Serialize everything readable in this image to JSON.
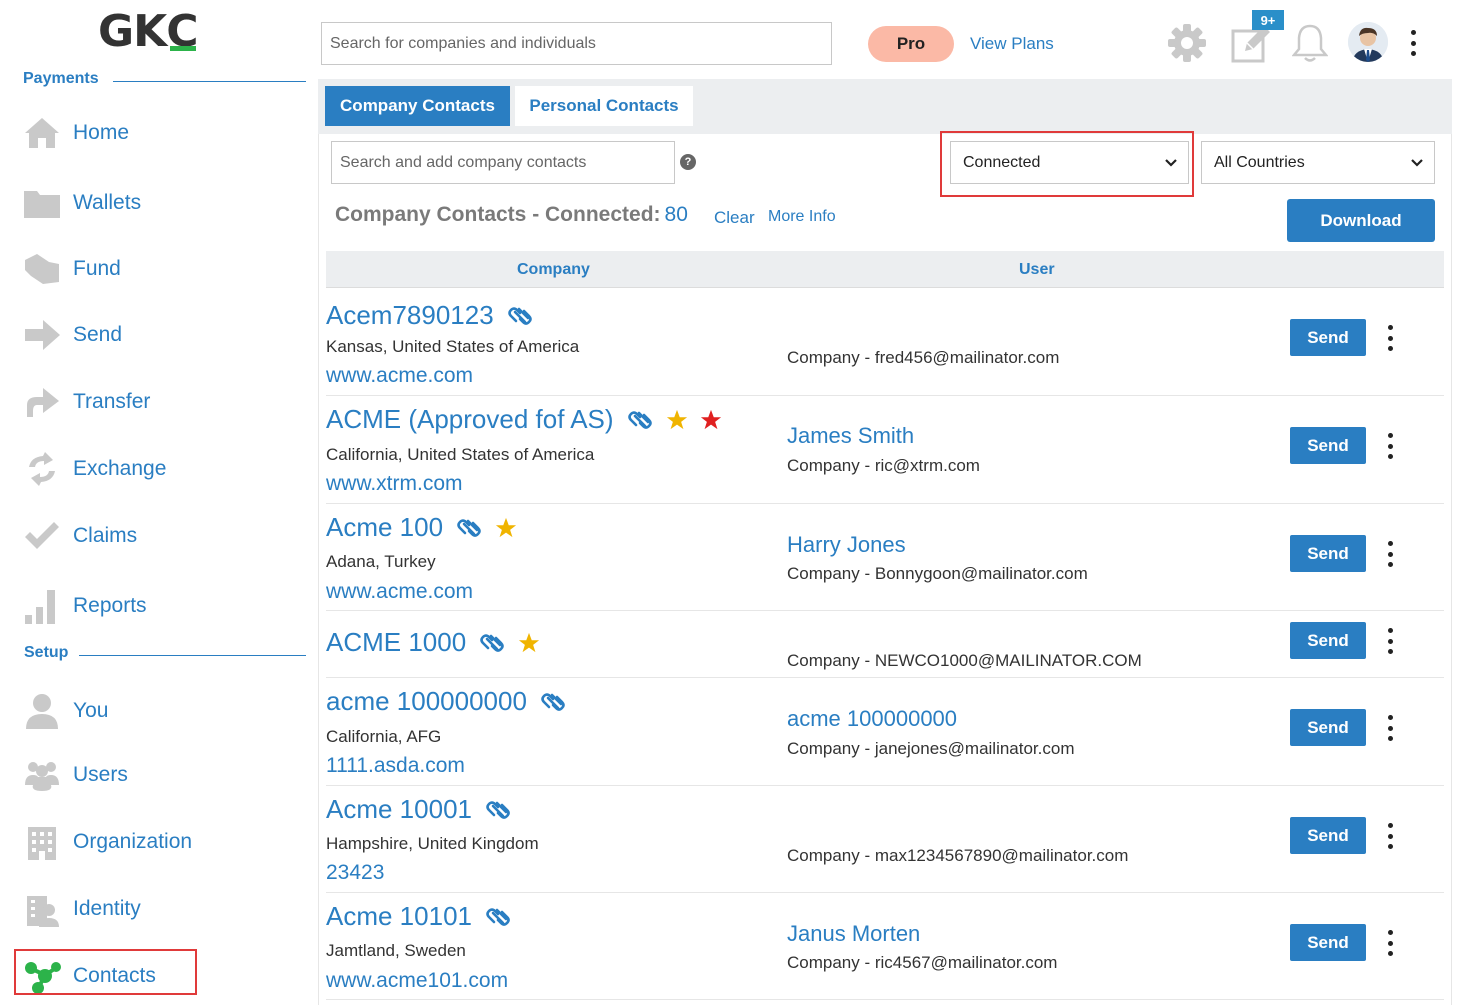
{
  "app": {
    "logo_text_main": "GK",
    "logo_text_c": "C"
  },
  "colors": {
    "accent": "#2a7ec2",
    "brand_green": "#2cb34a",
    "pro_badge": "#fbb9a6",
    "highlight": "#e03a3a",
    "star_gold": "#f0b400",
    "star_red": "#e02020"
  },
  "sidebar": {
    "payments_label": "Payments",
    "setup_label": "Setup",
    "payments_items": [
      {
        "label": "Home",
        "icon": "home-icon"
      },
      {
        "label": "Wallets",
        "icon": "folder-icon"
      },
      {
        "label": "Fund",
        "icon": "fund-icon"
      },
      {
        "label": "Send",
        "icon": "arrow-right-icon"
      },
      {
        "label": "Transfer",
        "icon": "transfer-icon"
      },
      {
        "label": "Exchange",
        "icon": "exchange-icon"
      },
      {
        "label": "Claims",
        "icon": "check-icon"
      },
      {
        "label": "Reports",
        "icon": "bar-chart-icon"
      }
    ],
    "setup_items": [
      {
        "label": "You",
        "icon": "user-icon"
      },
      {
        "label": "Users",
        "icon": "users-icon"
      },
      {
        "label": "Organization",
        "icon": "building-icon"
      },
      {
        "label": "Identity",
        "icon": "identity-icon"
      },
      {
        "label": "Contacts",
        "icon": "contacts-icon"
      }
    ]
  },
  "topbar": {
    "search_placeholder": "Search for companies and individuals",
    "pro_label": "Pro",
    "view_plans_label": "View Plans",
    "notes_badge": "9+"
  },
  "tabs": [
    {
      "label": "Company Contacts",
      "active": true
    },
    {
      "label": "Personal Contacts",
      "active": false
    }
  ],
  "filters": {
    "contact_search_placeholder": "Search and add company contacts",
    "help_glyph": "?",
    "status_value": "Connected",
    "country_value": "All Countries"
  },
  "summary": {
    "label": "Company Contacts - Connected:",
    "count": "80",
    "clear_label": "Clear",
    "more_info_label": "More Info",
    "download_label": "Download"
  },
  "table": {
    "headers": {
      "company": "Company",
      "user": "User"
    },
    "send_label": "Send",
    "rows": [
      {
        "company": "Acem7890123",
        "location": "Kansas, United States of America",
        "website": "www.acme.com",
        "user_name": "",
        "user_email": "Company - fred456@mailinator.com",
        "stars": []
      },
      {
        "company": "ACME (Approved fof AS)",
        "location": "California, United States of America",
        "website": "www.xtrm.com",
        "user_name": "James Smith",
        "user_email": "Company - ric@xtrm.com",
        "stars": [
          "gold",
          "red"
        ]
      },
      {
        "company": "Acme 100",
        "location": "Adana, Turkey",
        "website": "www.acme.com",
        "user_name": "Harry Jones",
        "user_email": "Company - Bonnygoon@mailinator.com",
        "stars": [
          "gold"
        ]
      },
      {
        "company": "ACME 1000",
        "location": "",
        "website": "",
        "user_name": "",
        "user_email": "Company - NEWCO1000@MAILINATOR.COM",
        "stars": [
          "gold"
        ]
      },
      {
        "company": "acme 100000000",
        "location": "California, AFG",
        "website": "1111.asda.com",
        "user_name": "acme 100000000",
        "user_email": "Company - janejones@mailinator.com",
        "stars": []
      },
      {
        "company": "Acme 10001",
        "location": "Hampshire, United Kingdom",
        "website": "23423",
        "user_name": "",
        "user_email": "Company - max1234567890@mailinator.com",
        "stars": []
      },
      {
        "company": "Acme 10101",
        "location": "Jamtland, Sweden",
        "website": "www.acme101.com",
        "user_name": "Janus Morten",
        "user_email": "Company - ric4567@mailinator.com",
        "stars": []
      }
    ]
  }
}
